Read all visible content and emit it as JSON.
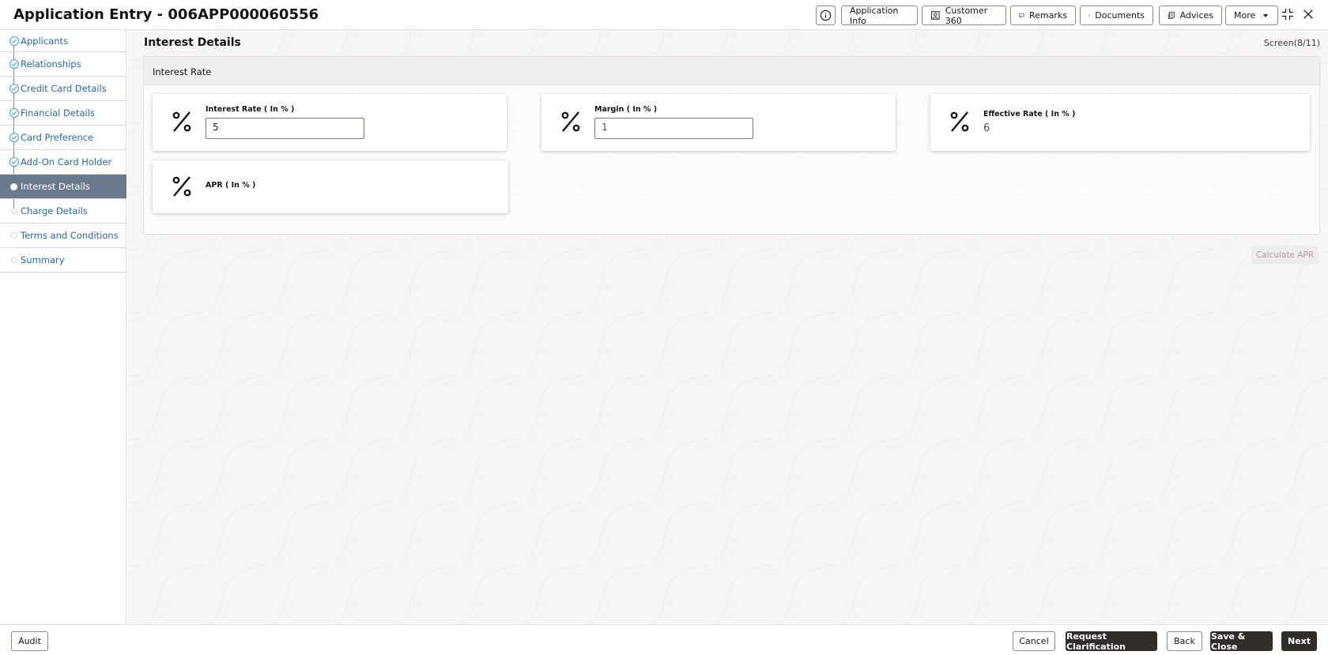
{
  "header": {
    "title": "Application Entry - 006APP000060556",
    "buttons": {
      "application_info": "Application Info",
      "customer_360": "Customer 360",
      "remarks": "Remarks",
      "documents": "Documents",
      "advices": "Advices",
      "more": "More"
    },
    "icons": [
      "info-icon",
      "person-card-icon",
      "chat-icon",
      "documents-icon",
      "advices-icon",
      "chevron-down-icon",
      "collapse-icon",
      "close-icon"
    ]
  },
  "sidebar": {
    "items": [
      {
        "label": "Applicants",
        "state": "done"
      },
      {
        "label": "Relationships",
        "state": "done"
      },
      {
        "label": "Credit Card Details",
        "state": "done"
      },
      {
        "label": "Financial Details",
        "state": "done"
      },
      {
        "label": "Card Preference",
        "state": "done"
      },
      {
        "label": "Add-On Card Holder",
        "state": "done"
      },
      {
        "label": "Interest Details",
        "state": "current"
      },
      {
        "label": "Charge Details",
        "state": "pending"
      },
      {
        "label": "Terms and Conditions",
        "state": "pending"
      },
      {
        "label": "Summary",
        "state": "pending"
      }
    ]
  },
  "main": {
    "page_title": "Interest Details",
    "screen_count": "Screen(8/11)",
    "section_title": "Interest Rate",
    "fields": {
      "interest_rate": {
        "label": "Interest Rate ( In % )",
        "value": "5"
      },
      "margin": {
        "label": "Margin ( In % )",
        "value": "1"
      },
      "effective_rate": {
        "label": "Effective Rate ( In % )",
        "value": "6"
      },
      "apr": {
        "label": "APR ( In % )",
        "value": ""
      }
    },
    "calculate_apr": "Calculate APR"
  },
  "footer": {
    "audit": "Audit",
    "cancel": "Cancel",
    "request_clarification": "Request Clarification",
    "back": "Back",
    "save_close": "Save & Close",
    "next": "Next"
  },
  "colors": {
    "accent": "#4b9bd6",
    "link": "#2a6aa0",
    "active_nav": "#6c7a8f",
    "dark_button": "#312d2a"
  }
}
